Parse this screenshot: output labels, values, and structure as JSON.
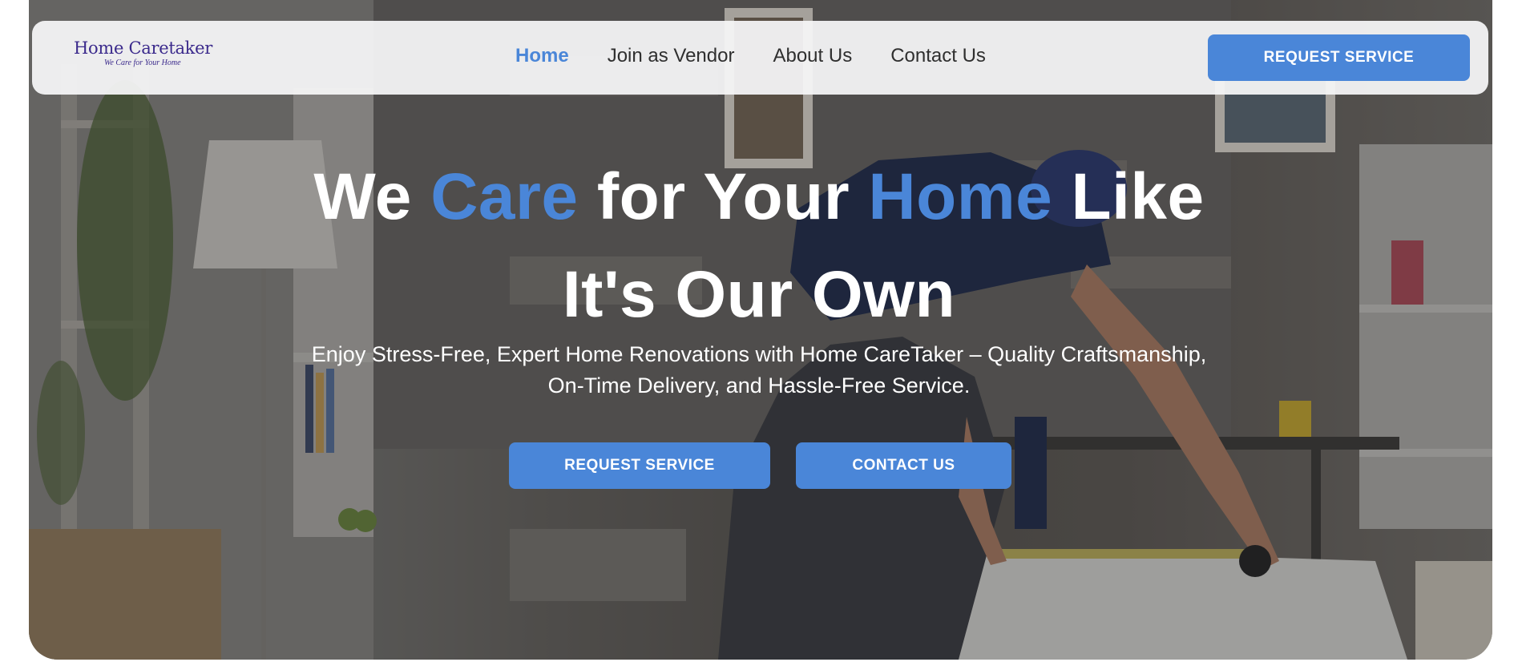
{
  "brand": {
    "name": "Home Caretaker",
    "tagline": "We Care for Your Home"
  },
  "nav": {
    "links": [
      {
        "label": "Home",
        "active": true
      },
      {
        "label": "Join as Vendor",
        "active": false
      },
      {
        "label": "About Us",
        "active": false
      },
      {
        "label": "Contact Us",
        "active": false
      }
    ],
    "cta_label": "REQUEST SERVICE"
  },
  "hero": {
    "headline": {
      "part1": "We ",
      "accent1": "Care",
      "part2": " for Your ",
      "accent2": "Home",
      "part3": " Like",
      "line2": "It's Our Own"
    },
    "subline_1": "Enjoy Stress-Free, Expert Home Renovations with Home CareTaker – Quality Craftsmanship,",
    "subline_2": "On-Time Delivery, and Hassle-Free Service.",
    "buttons": {
      "request": "REQUEST SERVICE",
      "contact": "CONTACT US"
    }
  },
  "colors": {
    "accent": "#4a86d8",
    "logo": "#3b2a8c",
    "nav_text": "#2f2f2f"
  }
}
